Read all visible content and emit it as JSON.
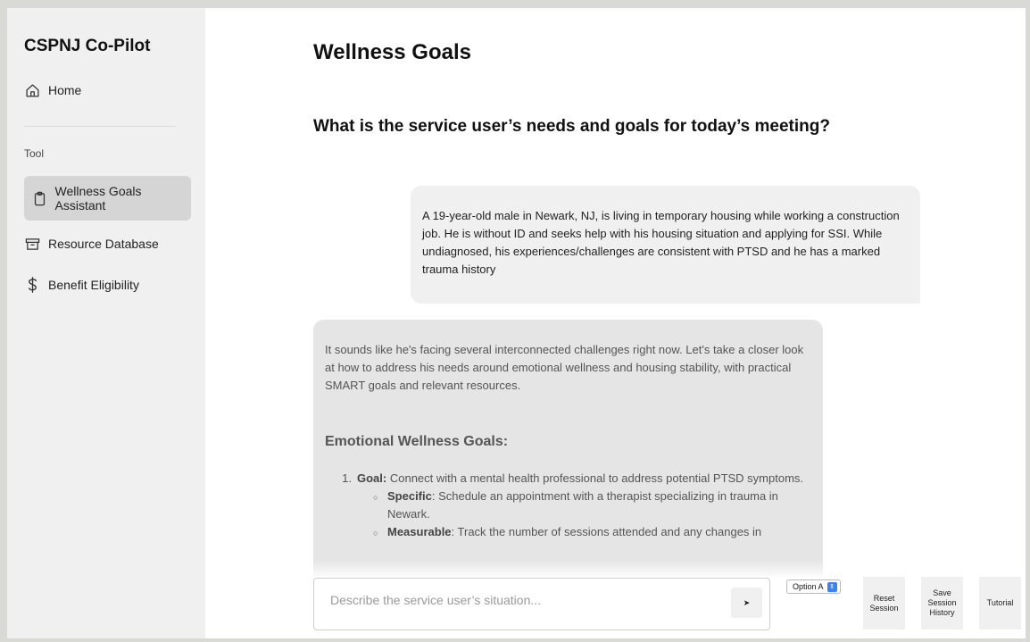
{
  "app": {
    "title": "CSPNJ Co-Pilot"
  },
  "sidebar": {
    "home_label": "Home",
    "section_label": "Tool",
    "items": [
      {
        "label": "Wellness Goals Assistant",
        "icon": "clipboard-icon",
        "active": true
      },
      {
        "label": "Resource Database",
        "icon": "archive-box-icon"
      },
      {
        "label": "Benefit Eligibility",
        "icon": "dollar-icon"
      }
    ]
  },
  "main": {
    "title": "Wellness Goals",
    "question": "What is the service user’s needs and goals for today’s meeting?"
  },
  "messages": {
    "user": "A 19-year-old male in Newark, NJ, is living in temporary housing while working a construction job. He is without ID and seeks help with his housing situation and applying for SSI. While undiagnosed, his experiences/challenges are consistent with PTSD and he has a marked trauma history",
    "assistant": {
      "intro": "It sounds like he's facing several interconnected challenges right now. Let's take a closer look at how to address his needs around emotional wellness and housing stability, with practical SMART goals and relevant resources.",
      "section_heading": "Emotional Wellness Goals:",
      "goal": {
        "number": "1.",
        "label": "Goal:",
        "text": " Connect with a mental health professional to address potential PTSD symptoms."
      },
      "sub_items": [
        {
          "label": "Specific",
          "text": ": Schedule an appointment with a therapist specializing in trauma in Newark."
        },
        {
          "label": "Measurable",
          "text": ": Track the number of sessions attended and any changes in"
        }
      ]
    }
  },
  "composer": {
    "placeholder": "Describe the service user’s situation...",
    "send_glyph": "➤"
  },
  "controls": {
    "option_select": "Option A",
    "reset_session": "Reset Session",
    "save_session_history": "Save Session History",
    "tutorial": "Tutorial"
  }
}
